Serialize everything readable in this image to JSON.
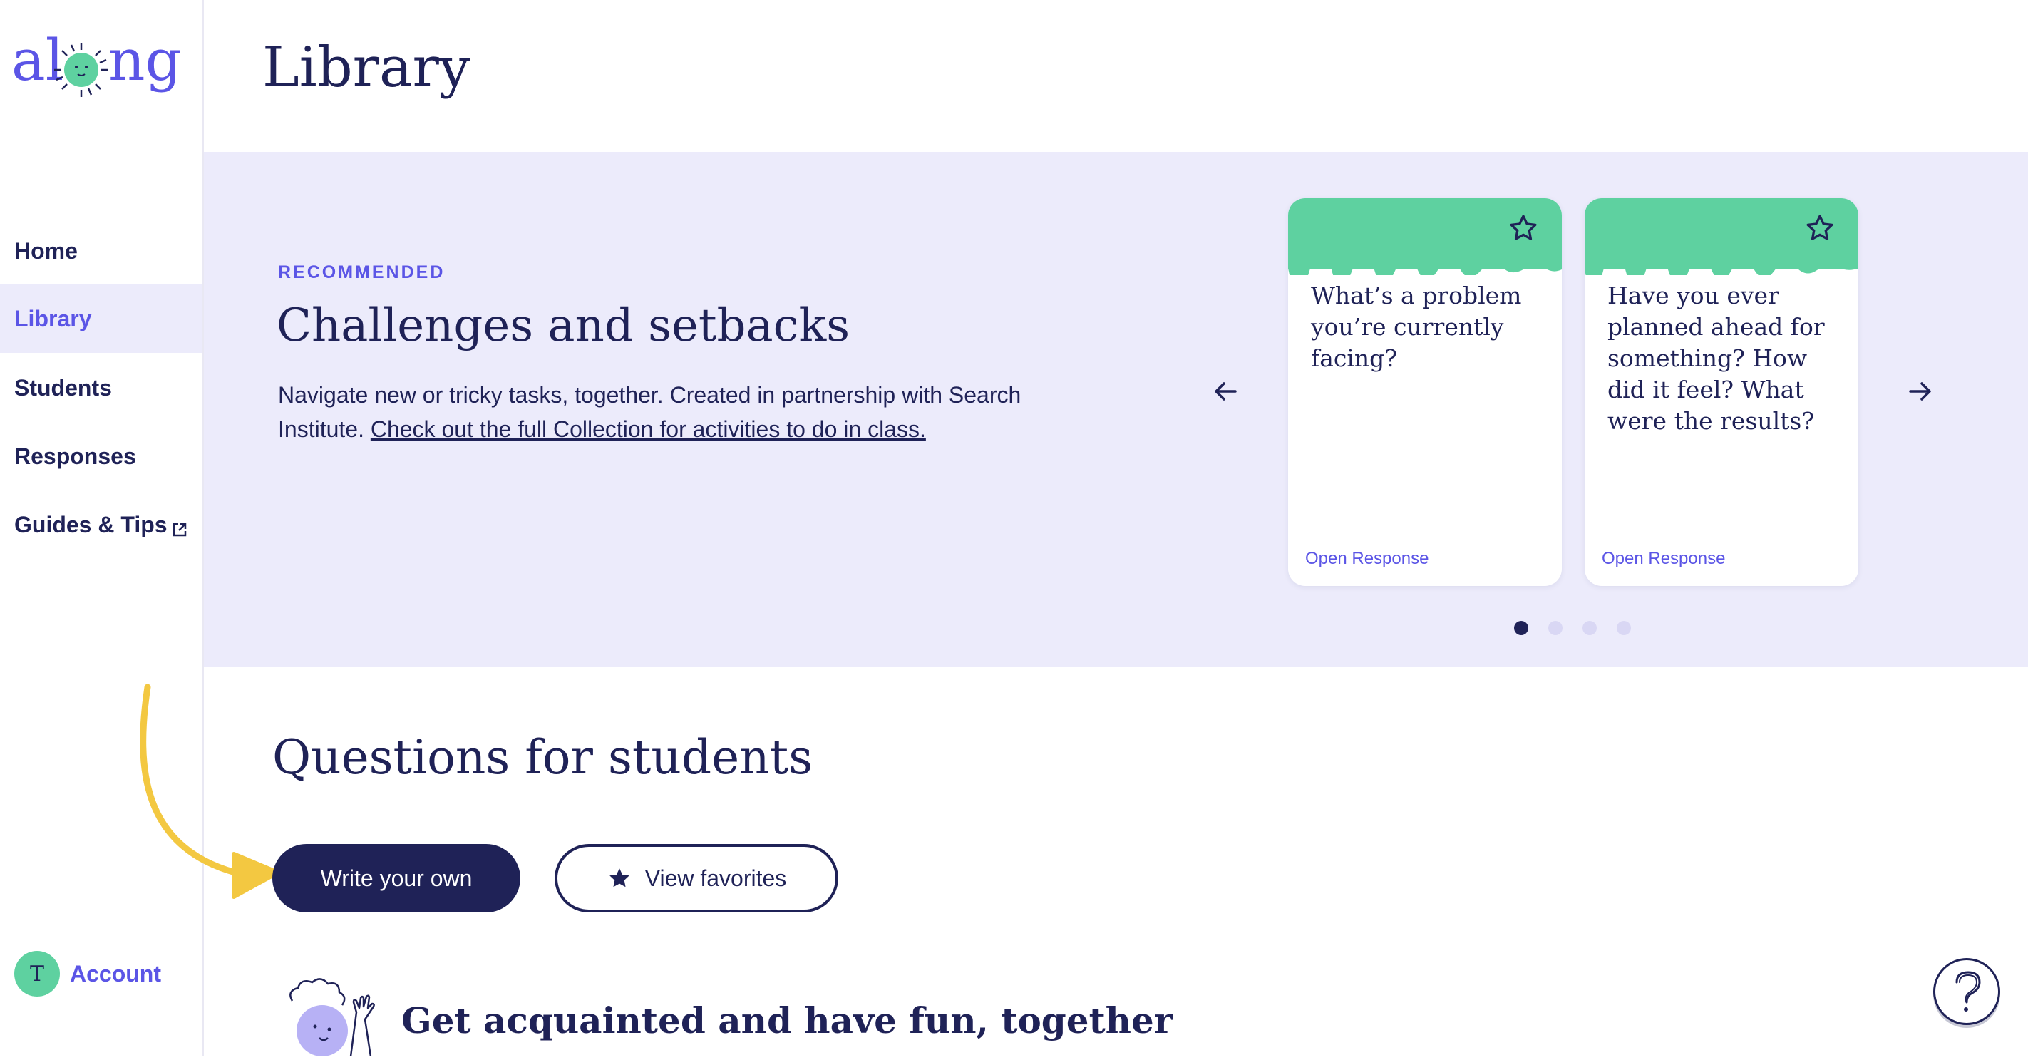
{
  "brand": {
    "logo_text": "along",
    "accent": "#5b55e6",
    "navy": "#1f2257",
    "mint": "#5ed1a0",
    "lavender": "#ecebfb"
  },
  "sidebar": {
    "items": [
      {
        "label": "Home",
        "active": false
      },
      {
        "label": "Library",
        "active": true
      },
      {
        "label": "Students",
        "active": false
      },
      {
        "label": "Responses",
        "active": false
      },
      {
        "label": "Guides & Tips",
        "active": false,
        "icon": "external-link-icon"
      }
    ],
    "account": {
      "avatar_initial": "T",
      "label": "Account"
    }
  },
  "header": {
    "title": "Library"
  },
  "recommended": {
    "eyebrow": "RECOMMENDED",
    "title": "Challenges and setbacks",
    "description": "Navigate new or tricky tasks, together. Created in partnership with Search Institute.",
    "link_text": "Check out the full Collection for activities to do in class.",
    "cards": [
      {
        "question": "What’s a problem you’re currently facing?",
        "type": "Open Response",
        "icon": "star-outline-icon"
      },
      {
        "question": "Have you ever planned ahead for something? How did it feel? What were the results?",
        "type": "Open Response",
        "icon": "star-outline-icon"
      }
    ],
    "pagination": {
      "total": 4,
      "current": 1
    }
  },
  "questions": {
    "title": "Questions for students",
    "write_button": "Write your own",
    "favorites_button": "View favorites"
  },
  "section": {
    "title": "Get acquainted and have fun, together"
  }
}
